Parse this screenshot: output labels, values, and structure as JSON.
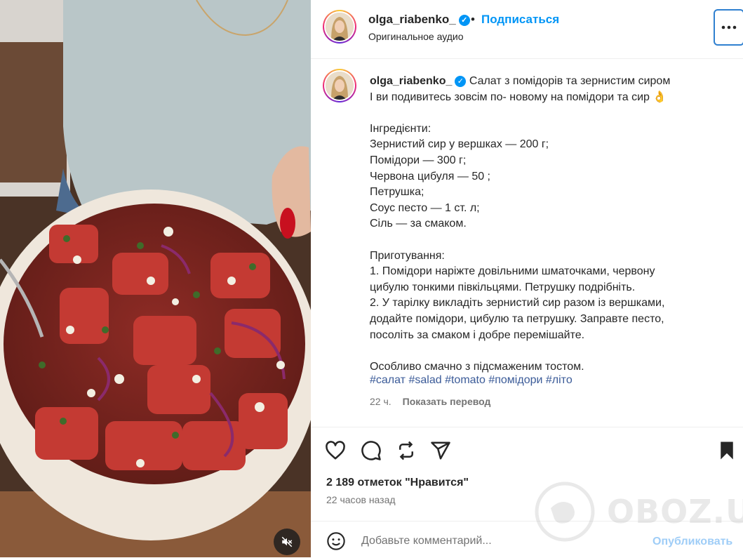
{
  "post": {
    "username": "olga_riabenko_",
    "follow_label": "Подписаться",
    "separator": "•",
    "audio": "Оригинальное аудио",
    "verified_mark": "✓"
  },
  "caption": {
    "username": "olga_riabenko_",
    "text": "Салат з помідорів та зернистим сиром\nІ ви подивитесь зовсім по- новому на помідори та сир 👌\n\nІнгредієнти:\nЗернистий сир у вершках — 200 г;\nПомідори — 300 г;\nЧервона цибуля — 50 ;\nПетрушка;\nСоус песто — 1 ст. л;\nСіль — за смаком.\n\nПриготування:\n1. Помідори наріжте довільними шматочками, червону\nцибулю тонкими півкільцями. Петрушку подрібніть.\n2. У тарілку викладіть зернистий сир разом із вершками,\nдодайте помідори, цибулю та петрушку. Заправте песто,\nпосоліть за смаком і добре перемішайте.\n\nОсобливо смачно з підсмаженим тостом.",
    "hashtags": [
      "#салат",
      "#salad",
      "#tomato",
      "#помідори",
      "#літо"
    ],
    "age": "22 ч.",
    "translate": "Показать перевод"
  },
  "stats": {
    "likes": "2 189 отметок \"Нравится\"",
    "time_ago": "22 часов назад"
  },
  "comment": {
    "placeholder": "Добавьте комментарий...",
    "publish": "Опубликовать"
  },
  "watermark": {
    "text": "OBOZ.UA"
  },
  "icons": {
    "like": "heart-icon",
    "comment": "comment-bubble-icon",
    "repost": "repost-icon",
    "share": "send-icon",
    "save": "bookmark-filled-icon",
    "more": "more-horizontal-icon",
    "emoji": "emoji-icon",
    "mute": "muted-speaker-icon"
  },
  "colors": {
    "accent": "#0095f6",
    "text": "#262626",
    "muted": "#737373",
    "hashtag": "#3b5b98"
  }
}
